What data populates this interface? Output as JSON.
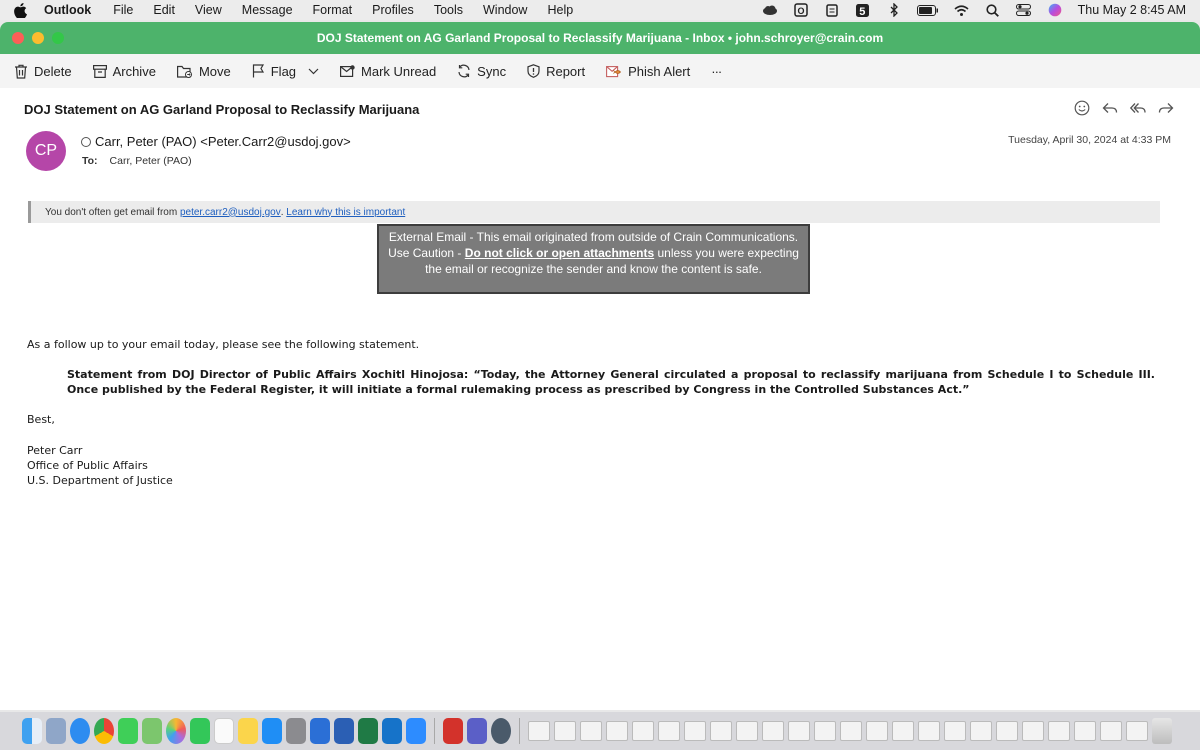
{
  "menubar": {
    "app_name": "Outlook",
    "items": [
      "File",
      "Edit",
      "View",
      "Message",
      "Format",
      "Profiles",
      "Tools",
      "Window",
      "Help"
    ],
    "clock": "Thu May 2  8:45 AM"
  },
  "window": {
    "title": "DOJ Statement on AG Garland Proposal to Reclassify Marijuana  - Inbox • john.schroyer@crain.com"
  },
  "toolbar": {
    "delete": "Delete",
    "archive": "Archive",
    "move": "Move",
    "flag": "Flag",
    "mark_unread": "Mark Unread",
    "sync": "Sync",
    "report": "Report",
    "phish_alert": "Phish Alert",
    "more": "···"
  },
  "message": {
    "subject": "DOJ Statement on AG Garland Proposal to Reclassify Marijuana",
    "avatar_initials": "CP",
    "sender": "Carr, Peter (PAO) <Peter.Carr2@usdoj.gov>",
    "to_label": "To:",
    "to_value": "Carr, Peter (PAO)",
    "date": "Tuesday, April 30, 2024 at 4:33 PM",
    "warning_prefix": "You don't often get email from",
    "warning_email": "peter.carr2@usdoj.gov",
    "warning_suffix": ".",
    "warning_link": "Learn why this is important",
    "external_line1": "External Email - This email originated from outside of Crain Communications.",
    "external_caution": "Use Caution -",
    "external_strong": "Do not click or open attachments",
    "external_rest": "unless you were expecting the email or recognize the sender and know the content is safe.",
    "intro": "As a follow up to your email today, please see the following statement.",
    "statement": "Statement from DOJ Director of Public Affairs Xochitl Hinojosa: “Today, the Attorney General circulated a proposal to reclassify marijuana from Schedule I to Schedule III. Once published by the Federal Register, it will initiate a formal rulemaking process as prescribed by Congress in the Controlled Substances Act.”",
    "closing": "Best,",
    "sig_name": "Peter Carr",
    "sig_office": "Office of Public Affairs",
    "sig_dept": "U.S. Department of Justice"
  },
  "colors": {
    "titlebar": "#4db36b",
    "avatar": "#b546a8",
    "banner": "#7b7b7b",
    "link": "#1f5fbf"
  }
}
